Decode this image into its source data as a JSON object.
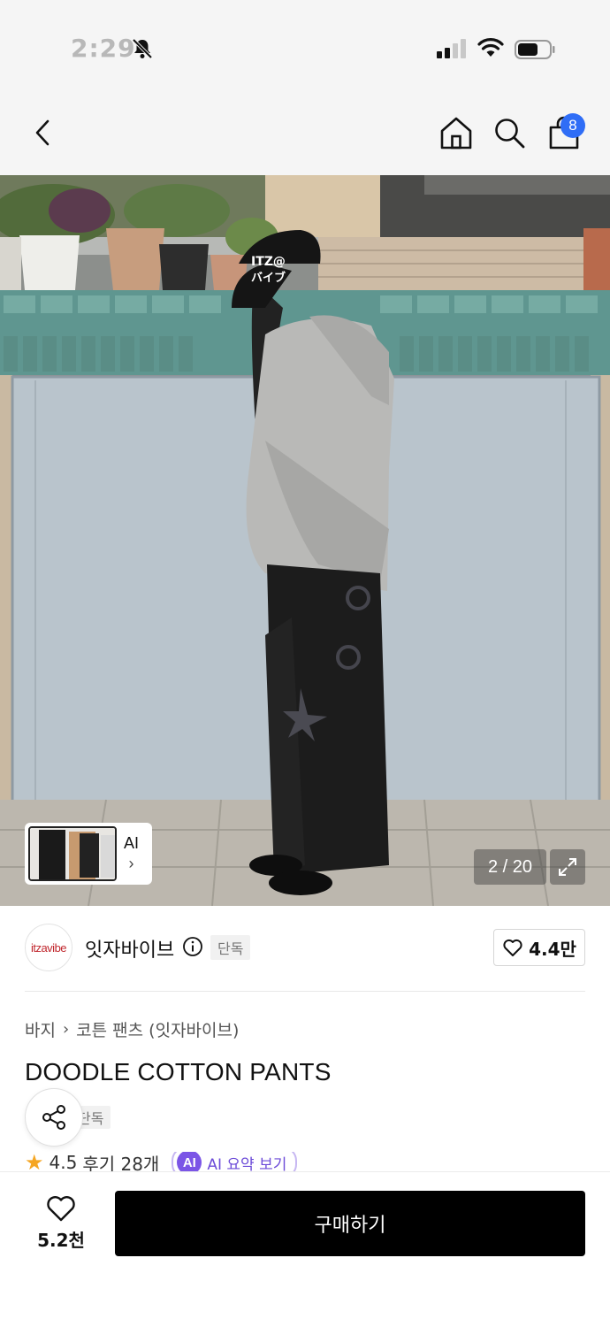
{
  "status_bar": {
    "time": "2:29",
    "icons": [
      "bell-off-icon",
      "signal-icon",
      "wifi-icon",
      "battery-icon"
    ]
  },
  "nav": {
    "icons": [
      "back-icon",
      "home-icon",
      "search-icon",
      "shopping-bag-icon"
    ],
    "cart_count": "8",
    "badge_color": "#2f6df6"
  },
  "hero": {
    "pager": "2 / 20",
    "thumb_ai_label": "AI",
    "thumb_ai_chevron": "›",
    "cap_text_line1": "ITZ@",
    "cap_text_line2": "バイブ"
  },
  "brand": {
    "logo_text": "itzavibe",
    "name": "잇자바이브",
    "exclusive_tag": "단독",
    "likes": "4.4만"
  },
  "product": {
    "breadcrumb": [
      "바지",
      "코튼 팬츠 (잇자바이브)"
    ],
    "title": "DOODLE COTTON PANTS",
    "tag": "단독",
    "rating": "4.5",
    "reviews": "후기 28개",
    "ai_badge": "AI",
    "ai_summary": "AI 요약 보기"
  },
  "bottom": {
    "wish_count": "5.2천",
    "buy_label": "구매하기"
  }
}
